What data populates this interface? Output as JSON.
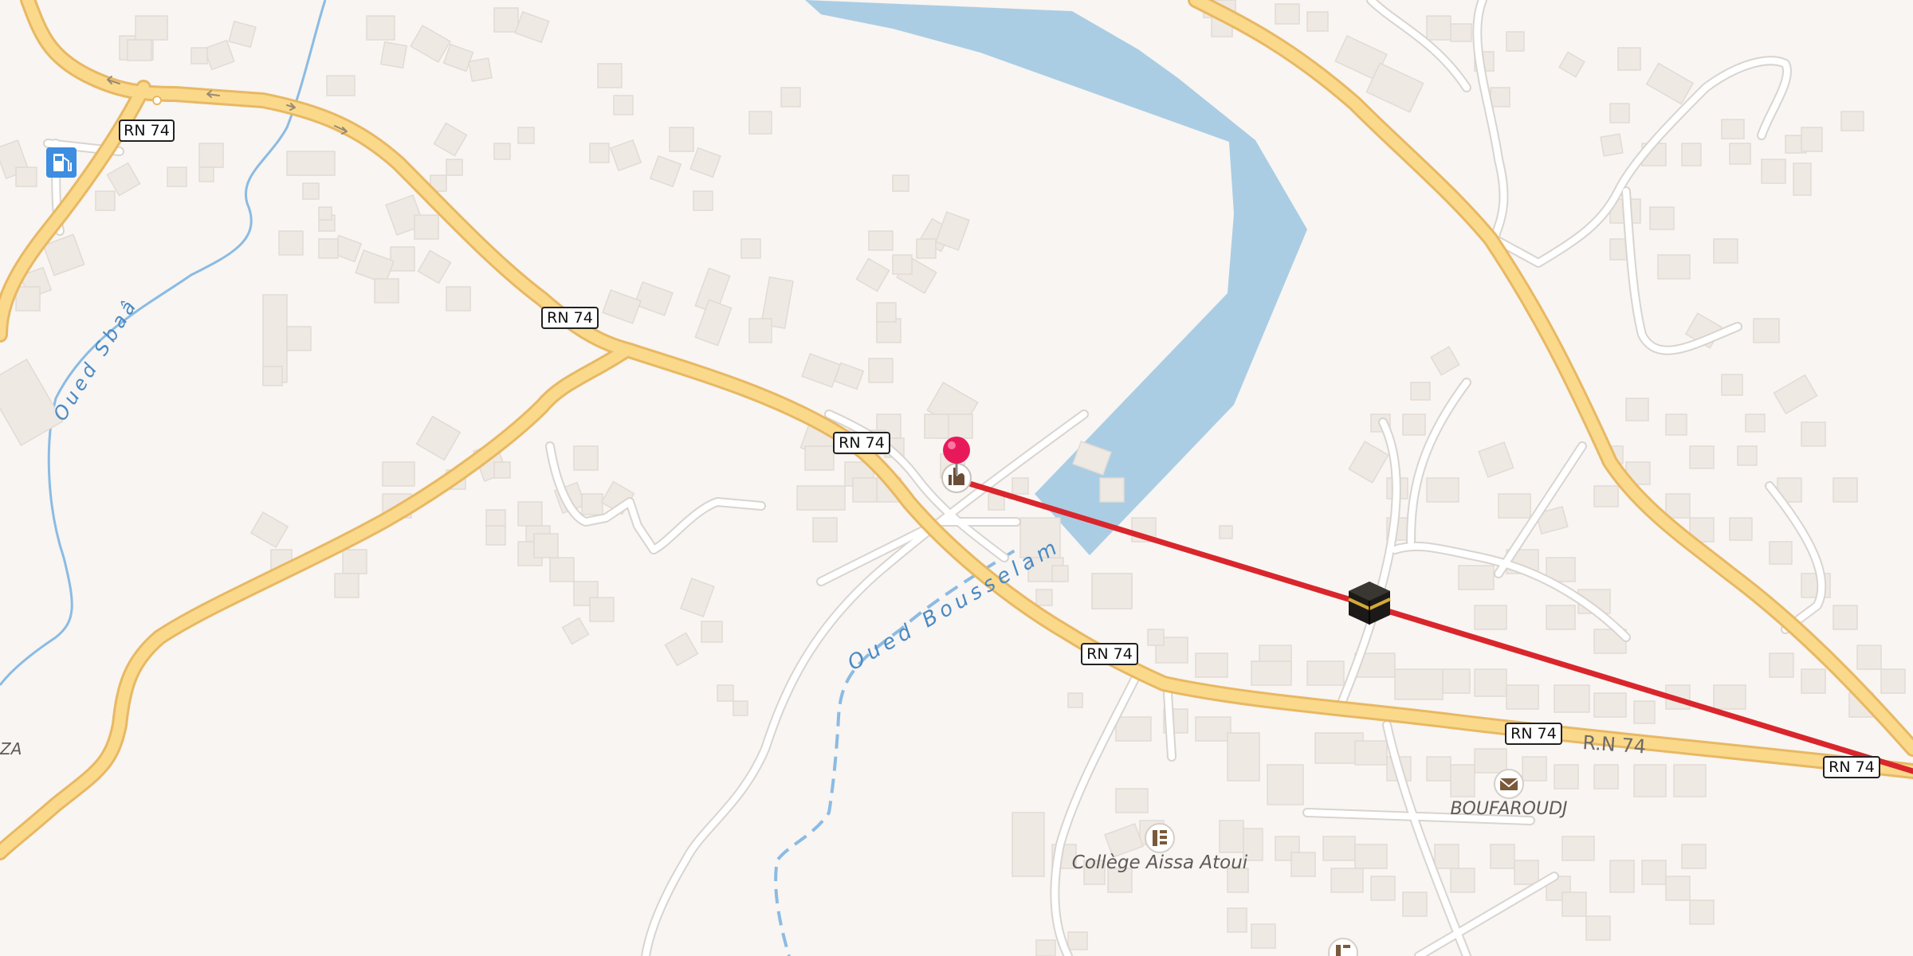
{
  "map": {
    "road_shields": [
      "RN 74",
      "RN 74",
      "RN 74",
      "RN 74",
      "RN 74",
      "RN 74"
    ],
    "road_name": "R.N 74",
    "waterways": [
      "Oued Sbaâ",
      "Oued Bousselam"
    ],
    "places": {
      "college": "Collège Aissa Atoui",
      "post": "BOUFAROUDJ",
      "edge_fragment": "ZA"
    },
    "markers": {
      "pin": "location-pin",
      "mosque": "mosque-icon",
      "kaaba": "kaaba-icon",
      "fuel": "fuel-station-icon",
      "post": "post-office-icon",
      "school": "school-icon"
    },
    "colors": {
      "background": "#f8f5f2",
      "water": "#aacde4",
      "road_major": "#fad98b",
      "road_major_casing": "#e8b864",
      "road_minor": "#ffffff",
      "road_minor_casing": "#d9d4cf",
      "building": "#efe9e3",
      "stream": "#8bbbe3",
      "qibla_line": "#d9262c",
      "pin": "#e8195a"
    }
  }
}
